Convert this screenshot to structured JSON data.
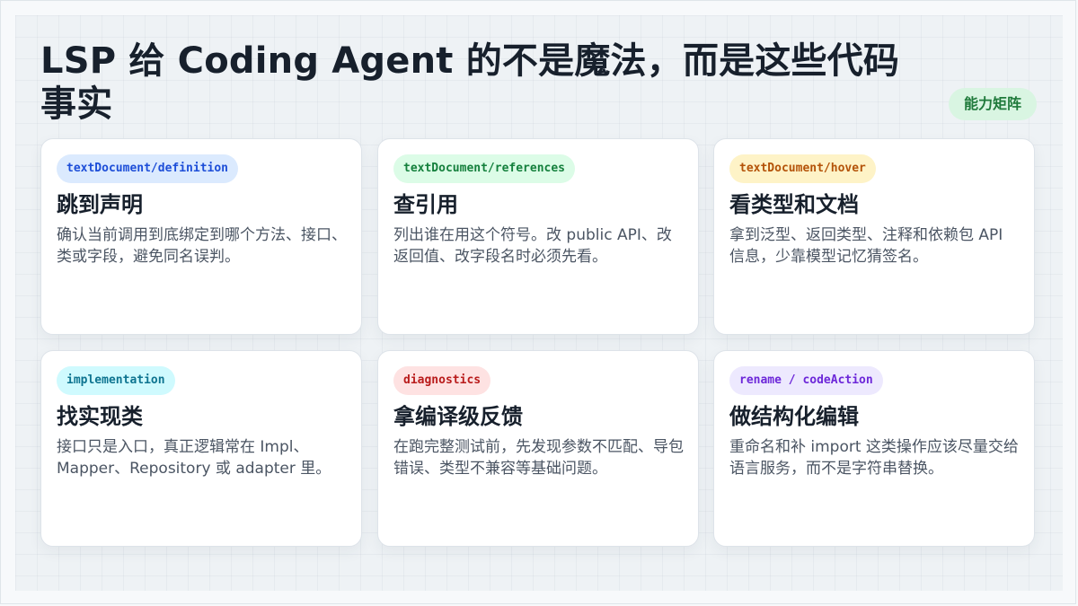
{
  "title": "LSP 给 Coding Agent 的不是魔法，而是这些代码事实",
  "badge": "能力矩阵",
  "colors": {
    "blue_tag_bg": "#dbeafe",
    "blue_tag_text": "#1d4ed8",
    "green_tag_bg": "#dcfce7",
    "green_tag_text": "#15803d",
    "yellow_tag_bg": "#fef3c7",
    "yellow_tag_text": "#b45309",
    "cyan_tag_bg": "#cffafe",
    "cyan_tag_text": "#0e7490",
    "red_tag_bg": "#fee2e2",
    "red_tag_text": "#b91c1c",
    "purple_tag_bg": "#ede9fe",
    "purple_tag_text": "#6d28d9"
  },
  "cards": [
    {
      "tag": "textDocument/definition",
      "title": "跳到声明",
      "desc": "确认当前调用到底绑定到哪个方法、接口、类或字段，避免同名误判。"
    },
    {
      "tag": "textDocument/references",
      "title": "查引用",
      "desc": "列出谁在用这个符号。改 public API、改返回值、改字段名时必须先看。"
    },
    {
      "tag": "textDocument/hover",
      "title": "看类型和文档",
      "desc": "拿到泛型、返回类型、注释和依赖包 API 信息，少靠模型记忆猜签名。"
    },
    {
      "tag": "implementation",
      "title": "找实现类",
      "desc": "接口只是入口，真正逻辑常在 Impl、Mapper、Repository 或 adapter 里。"
    },
    {
      "tag": "diagnostics",
      "title": "拿编译级反馈",
      "desc": "在跑完整测试前，先发现参数不匹配、导包错误、类型不兼容等基础问题。"
    },
    {
      "tag": "rename / codeAction",
      "title": "做结构化编辑",
      "desc": "重命名和补 import 这类操作应该尽量交给语言服务，而不是字符串替换。"
    }
  ]
}
